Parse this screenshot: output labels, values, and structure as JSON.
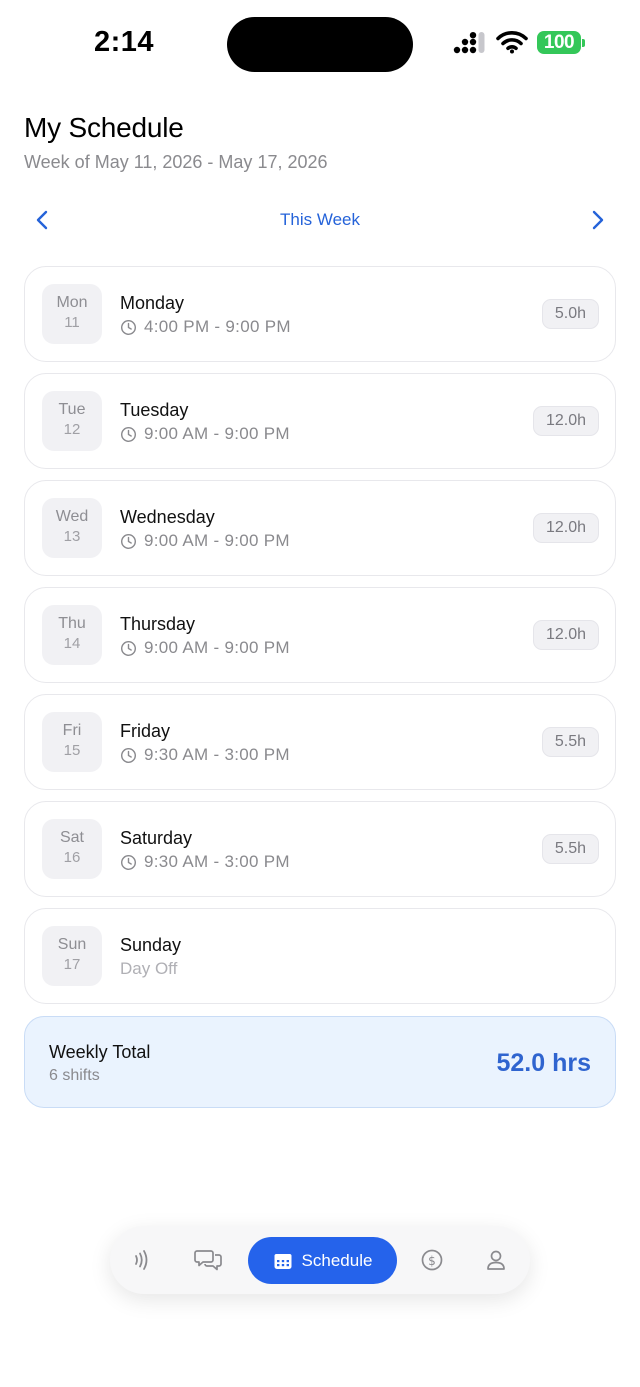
{
  "status_bar": {
    "time": "2:14",
    "battery": "100",
    "icons": [
      "cellular-signal-icon",
      "wifi-icon",
      "battery-icon"
    ]
  },
  "header": {
    "title": "My Schedule",
    "subtitle": "Week of May 11, 2026 - May 17, 2026"
  },
  "week_nav": {
    "label": "This Week",
    "prev_icon": "chevron-left-icon",
    "next_icon": "chevron-right-icon"
  },
  "days": [
    {
      "dow": "Mon",
      "date": "11",
      "name": "Monday",
      "time": "4:00 PM - 9:00 PM",
      "hours": "5.0h"
    },
    {
      "dow": "Tue",
      "date": "12",
      "name": "Tuesday",
      "time": "9:00 AM - 9:00 PM",
      "hours": "12.0h"
    },
    {
      "dow": "Wed",
      "date": "13",
      "name": "Wednesday",
      "time": "9:00 AM - 9:00 PM",
      "hours": "12.0h"
    },
    {
      "dow": "Thu",
      "date": "14",
      "name": "Thursday",
      "time": "9:00 AM - 9:00 PM",
      "hours": "12.0h"
    },
    {
      "dow": "Fri",
      "date": "15",
      "name": "Friday",
      "time": "9:30 AM - 3:00 PM",
      "hours": "5.5h"
    },
    {
      "dow": "Sat",
      "date": "16",
      "name": "Saturday",
      "time": "9:30 AM - 3:00 PM",
      "hours": "5.5h"
    },
    {
      "dow": "Sun",
      "date": "17",
      "name": "Sunday",
      "time": "Day Off"
    }
  ],
  "total": {
    "label": "Weekly Total",
    "shifts": "6 shifts",
    "hours": "52.0 hrs"
  },
  "tab_bar": {
    "tabs": [
      {
        "icon": "nfc-signal-icon"
      },
      {
        "icon": "chat-bubbles-icon"
      },
      {
        "icon": "calendar-icon",
        "label": "Schedule",
        "active": true
      },
      {
        "icon": "dollar-icon"
      },
      {
        "icon": "person-icon"
      }
    ]
  },
  "colors": {
    "accent": "#2563eb",
    "accent_text": "#2563d9",
    "total_bg": "#eaf3fe",
    "battery_green": "#34c759"
  }
}
